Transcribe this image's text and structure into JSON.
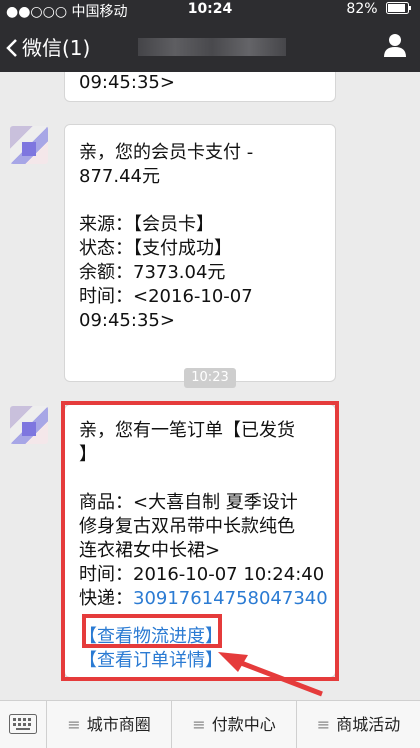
{
  "status_bar": {
    "carrier": "●●○○○ 中国移动",
    "time": "10:24",
    "battery": "82%"
  },
  "nav": {
    "back_label": "微信(1)"
  },
  "messages": [
    {
      "lines": [
        "09:45:35>"
      ]
    },
    {
      "lines": [
        "亲，您的会员卡支付 -",
        "877.44元",
        "",
        "来源：【会员卡】",
        "状态：【支付成功】",
        "余额：7373.04元",
        "时间：<2016-10-07",
        "09:45:35>"
      ]
    },
    {
      "timestamp": "10:23"
    },
    {
      "lines": [
        "亲，您有一笔订单【已发货",
        "】",
        "",
        "商品：<大喜自制 夏季设计",
        "修身复古双吊带中长款纯色",
        "连衣裙女中长裙>",
        "时间：2016-10-07 10:24:40"
      ],
      "express_label": "快递：",
      "express_number": "30917614758047340",
      "link_logistics": "【查看物流进度】",
      "link_order": "【查看订单详情】"
    }
  ],
  "toolbar": {
    "menus": [
      "城市商圈",
      "付款中心",
      "商城活动"
    ]
  },
  "colors": {
    "header_bg": "#2d2d30",
    "link": "#2b7bd3",
    "annotation_red": "#e53b3b"
  }
}
